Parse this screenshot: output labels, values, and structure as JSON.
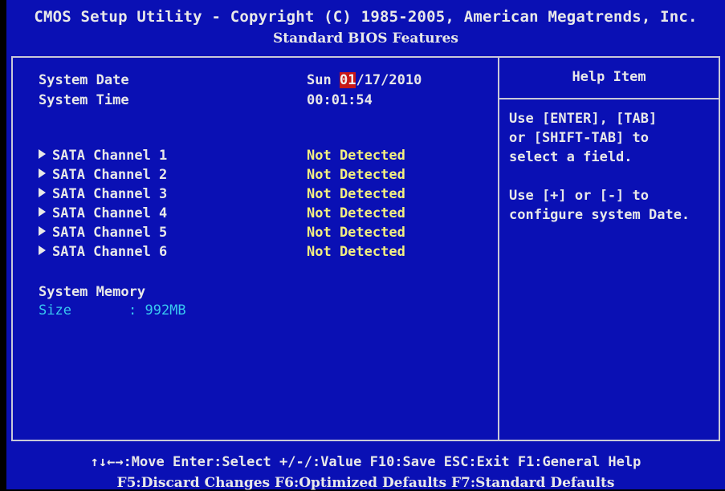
{
  "header": {
    "title": "CMOS Setup Utility - Copyright (C) 1985-2005, American Megatrends, Inc.",
    "subtitle": "Standard BIOS Features"
  },
  "main": {
    "system_date": {
      "label": "System Date",
      "day": "Sun",
      "month": "01",
      "rest": "/17/2010"
    },
    "system_time": {
      "label": "System Time",
      "value": "00:01:54"
    },
    "sata_channels": [
      {
        "label": "SATA Channel 1",
        "value": "Not Detected"
      },
      {
        "label": "SATA Channel 2",
        "value": "Not Detected"
      },
      {
        "label": "SATA Channel 3",
        "value": "Not Detected"
      },
      {
        "label": "SATA Channel 4",
        "value": "Not Detected"
      },
      {
        "label": "SATA Channel 5",
        "value": "Not Detected"
      },
      {
        "label": "SATA Channel 6",
        "value": "Not Detected"
      }
    ],
    "system_memory": {
      "heading": "System Memory",
      "size_label": "Size",
      "size_value": ": 992MB"
    }
  },
  "help": {
    "title": "Help Item",
    "lines": [
      "Use [ENTER], [TAB]",
      "or [SHIFT-TAB] to",
      "select a field.",
      "Use [+] or [-] to",
      "configure system Date."
    ]
  },
  "footer": {
    "line1": "↑↓←→:Move  Enter:Select  +/-/:Value  F10:Save  ESC:Exit  F1:General Help",
    "line2": "F5:Discard Changes   F6:Optimized Defaults   F7:Standard Defaults"
  },
  "colors": {
    "background": "#0a10b4",
    "text": "#e8e8e8",
    "value_yellow": "#f4f080",
    "highlight": "#c81818",
    "cyan": "#38c8f0"
  }
}
